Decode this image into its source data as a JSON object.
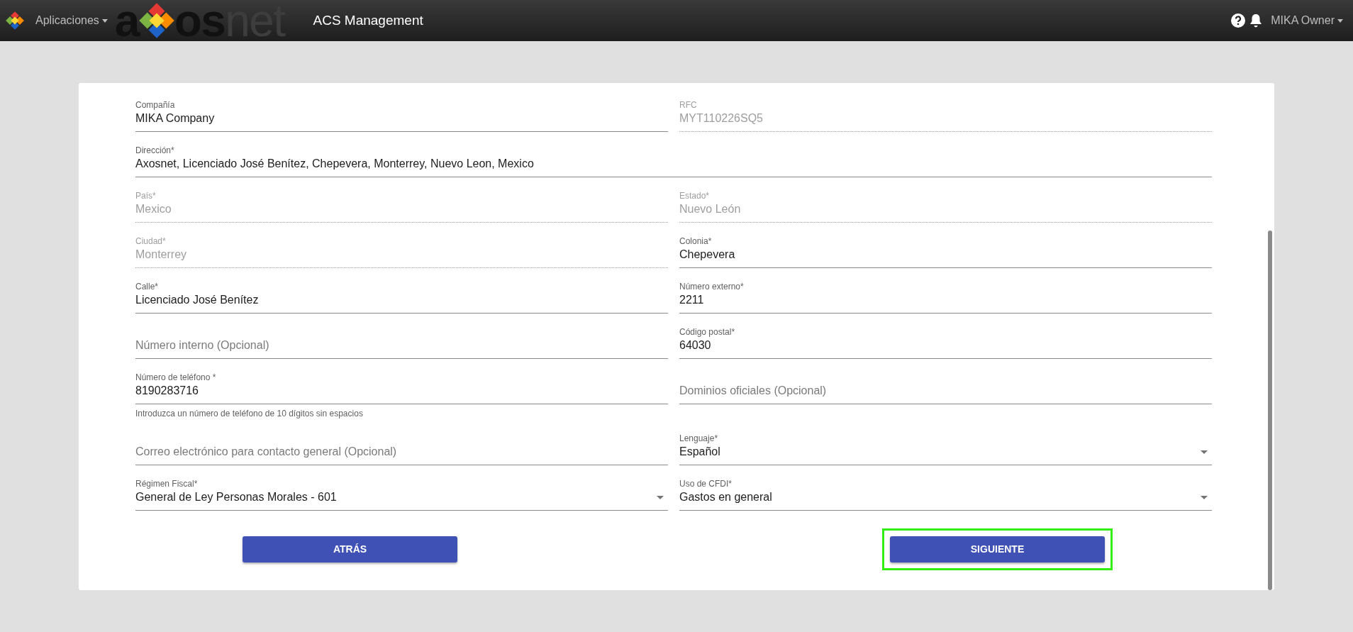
{
  "header": {
    "apps_menu": "Aplicaciones",
    "brand_parts": [
      {
        "text": "a",
        "muted": false
      },
      {
        "text": "os",
        "muted": false
      },
      {
        "text": "net",
        "muted": true
      }
    ],
    "title": "ACS Management",
    "user_menu": "MIKA Owner"
  },
  "rows": [
    [
      {
        "kind": "text",
        "label": "Compañía",
        "value": "MIKA Company",
        "disabled": false
      },
      {
        "kind": "text",
        "label": "RFC",
        "value": "MYT110226SQ5",
        "disabled": true
      }
    ],
    [
      {
        "kind": "text",
        "label": "Dirección*",
        "value": "Axosnet, Licenciado José Benítez, Chepevera, Monterrey, Nuevo Leon, Mexico",
        "disabled": false
      }
    ],
    [
      {
        "kind": "text",
        "label": "País*",
        "value": "Mexico",
        "disabled": true
      },
      {
        "kind": "text",
        "label": "Estado*",
        "value": "Nuevo León",
        "disabled": true
      }
    ],
    [
      {
        "kind": "text",
        "label": "Ciudad*",
        "value": "Monterrey",
        "disabled": true
      },
      {
        "kind": "text",
        "label": "Colonia*",
        "value": "Chepevera",
        "disabled": false
      }
    ],
    [
      {
        "kind": "text",
        "label": "Calle*",
        "value": "Licenciado José Benítez",
        "disabled": false
      },
      {
        "kind": "text",
        "label": "Número externo*",
        "value": "2211",
        "disabled": false
      }
    ],
    [
      {
        "kind": "text",
        "placeholder": "Número interno (Opcional)",
        "disabled": false
      },
      {
        "kind": "text",
        "label": "Código postal*",
        "value": "64030",
        "disabled": false
      }
    ],
    [
      {
        "kind": "text",
        "label": "Número de teléfono *",
        "value": "8190283716",
        "helper": "Introduzca un número de teléfono de 10 dígitos sin espacios",
        "disabled": false
      },
      {
        "kind": "text",
        "placeholder": "Dominios oficiales (Opcional)",
        "disabled": false
      }
    ],
    [
      {
        "kind": "text",
        "placeholder": "Correo electrónico para contacto general (Opcional)",
        "disabled": false
      },
      {
        "kind": "select",
        "label": "Lenguaje*",
        "value": "Español",
        "disabled": false
      }
    ],
    [
      {
        "kind": "select",
        "label": "Régimen Fiscal*",
        "value": "General de Ley Personas Morales - 601",
        "disabled": false
      },
      {
        "kind": "select",
        "label": "Uso de CFDI*",
        "value": "Gastos en general",
        "disabled": false
      }
    ]
  ],
  "buttons": [
    {
      "label": "ATRÁS",
      "highlighted": false
    },
    {
      "label": "SIGUIENTE",
      "highlighted": true
    }
  ]
}
